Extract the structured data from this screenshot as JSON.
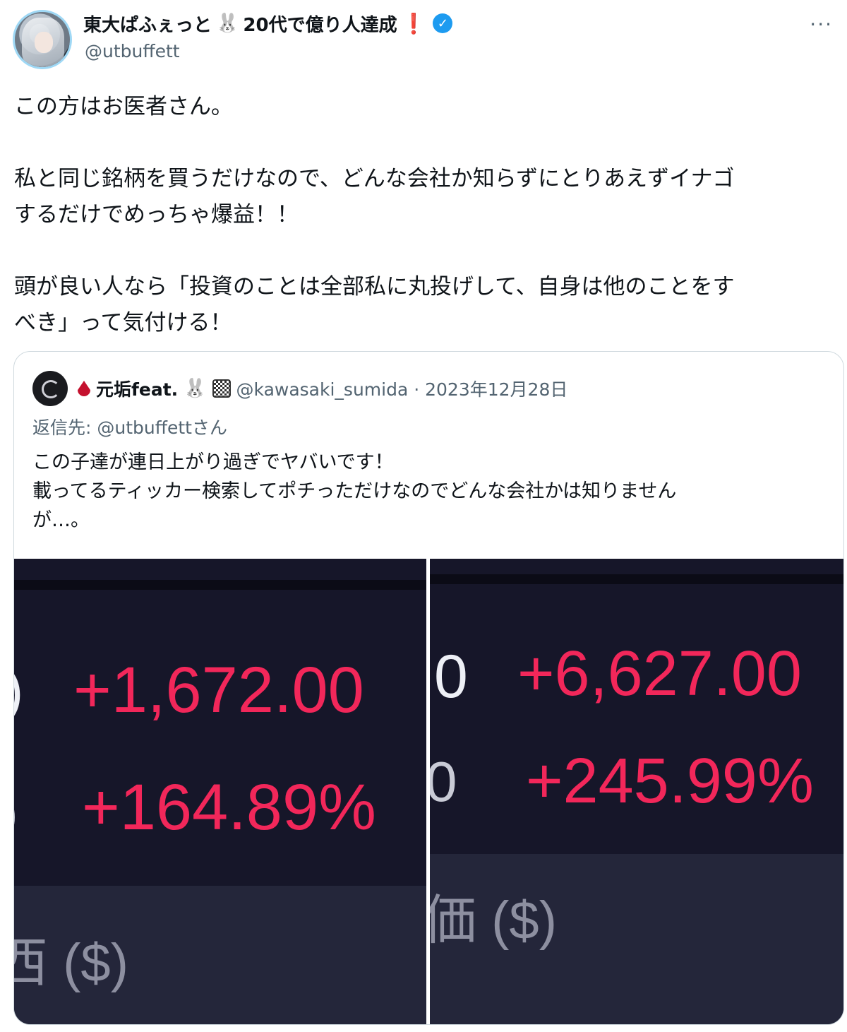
{
  "author": {
    "display_name": "東大ぱふぇっと",
    "rabbit_emoji": "🐰",
    "name_suffix": "20代で億り人達成",
    "exclaim": "❗",
    "handle": "@utbuffett",
    "verified_icon": "verified-badge-icon",
    "more_label": "···"
  },
  "tweet": {
    "lines": [
      "この方はお医者さん。",
      "",
      "私と同じ銘柄を買うだけなので、どんな会社か知らずにとりあえずイナゴ",
      "するだけでめっちゃ爆益！！",
      "",
      "頭が良い人なら「投資のことは全部私に丸投げして、自身は他のことをす",
      "べき」って気付ける！"
    ]
  },
  "quote": {
    "name": "元垢feat.",
    "rabbit_emoji": "🐰",
    "handle_date": "@kawasaki_sumida · 2023年12月28日",
    "reply_to": "返信先: @utbuffettさん",
    "lines": [
      "この子達が連日上がり過ぎでヤバいです！",
      "載ってるティッカー検索してポチっただけなのでどんな会社かは知りません",
      "が…。"
    ],
    "images": [
      {
        "gain": "+1,672.00",
        "percent": "+164.89%",
        "cut_left_top": ")",
        "cut_left_bottom": ")",
        "label": "西 ($)"
      },
      {
        "gain": "+6,627.00",
        "percent": "+245.99%",
        "cut_left_top": "0",
        "cut_left_bottom": "0",
        "label": "価 ($)"
      }
    ],
    "colors": {
      "gain_red": "#f2275a",
      "panel_bg": "#161629"
    }
  }
}
